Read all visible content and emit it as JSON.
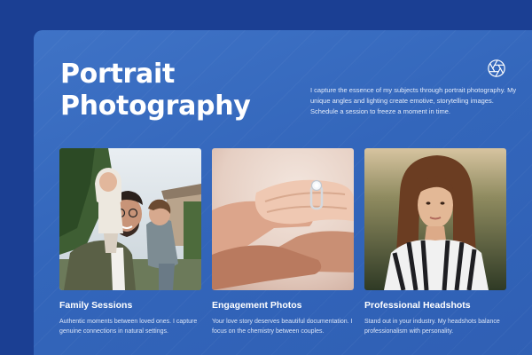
{
  "hero": {
    "title": "Portrait Photography",
    "intro": "I capture the essence of my subjects through portrait photography. My unique angles and lighting create emotive, storytelling images. Schedule a session to freeze a moment in time."
  },
  "icons": {
    "brand": "camera-aperture-icon"
  },
  "services": [
    {
      "title": "Family Sessions",
      "description": "Authentic moments between loved ones. I capture genuine connections in natural settings."
    },
    {
      "title": "Engagement Photos",
      "description": "Your love story deserves beautiful documentation. I focus on the chemistry between couples."
    },
    {
      "title": "Professional Headshots",
      "description": "Stand out in your industry. My headshots balance professionalism with personality."
    }
  ],
  "colors": {
    "background": "#1b3f93",
    "panel": "#3869bd",
    "text": "#ffffff"
  }
}
